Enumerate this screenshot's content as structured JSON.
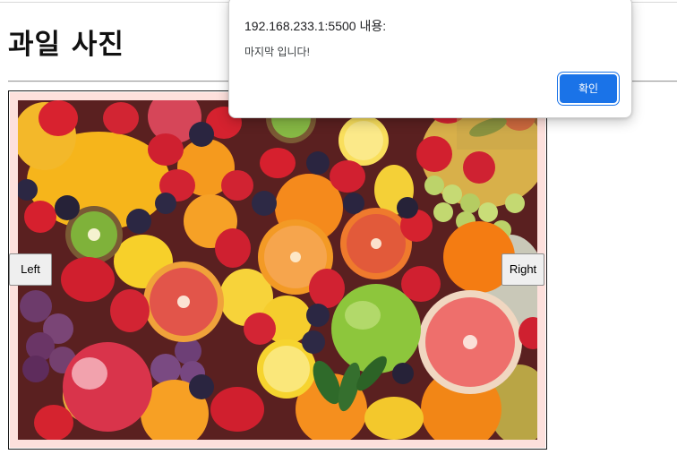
{
  "page": {
    "title": "과일 사진"
  },
  "gallery": {
    "image_alt": "fruit-photo",
    "left_label": "Left",
    "right_label": "Right"
  },
  "alert": {
    "origin": "192.168.233.1:5500 내용:",
    "message": "마지막 입니다!",
    "ok_label": "확인"
  },
  "colors": {
    "dialog_button": "#1a73e8",
    "photo_mat": "#fde0dc"
  }
}
